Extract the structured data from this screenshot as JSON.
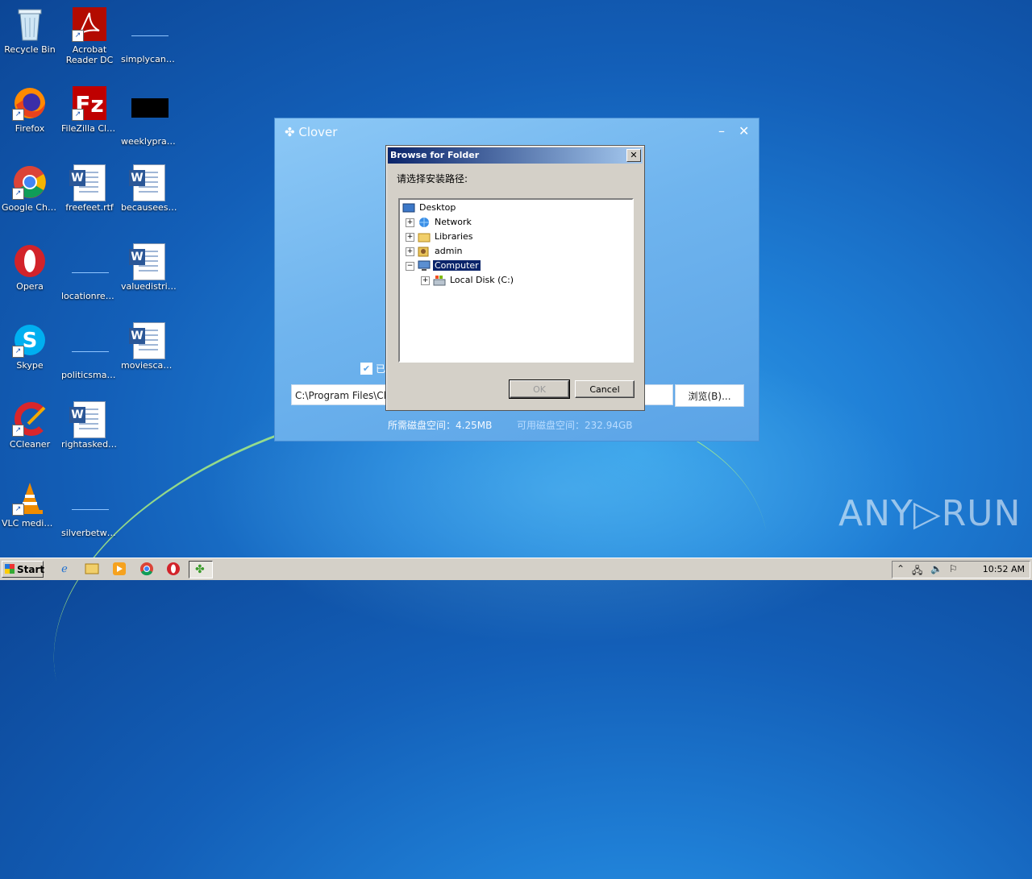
{
  "desktop": {
    "icons": [
      {
        "label": "Recycle Bin"
      },
      {
        "label": "Acrobat Reader DC"
      },
      {
        "label": "simplycance..."
      },
      {
        "label": "Firefox"
      },
      {
        "label": "FileZilla Client"
      },
      {
        "label": "weeklypract..."
      },
      {
        "label": "Google Chrome"
      },
      {
        "label": "freefeet.rtf"
      },
      {
        "label": "becauseest..."
      },
      {
        "label": "Opera"
      },
      {
        "label": "locationrent..."
      },
      {
        "label": "valuedistrib..."
      },
      {
        "label": "Skype"
      },
      {
        "label": "politicsmachi..."
      },
      {
        "label": "moviescapit..."
      },
      {
        "label": "CCleaner"
      },
      {
        "label": "rightasked.rtf"
      },
      {
        "label": "VLC media player"
      },
      {
        "label": "silverbetwe..."
      }
    ]
  },
  "clover": {
    "title": "Clover",
    "checkbox_label": "已",
    "install_path": "C:\\Program Files\\Cl",
    "browse_label": "浏览(B)...",
    "required_space": "所需磁盘空间：4.25MB",
    "available_space": "可用磁盘空间：232.94GB"
  },
  "dialog": {
    "title": "Browse for Folder",
    "close_glyph": "✕",
    "prompt": "请选择安装路径:",
    "tree": [
      {
        "label": "Desktop"
      },
      {
        "label": "Network"
      },
      {
        "label": "Libraries"
      },
      {
        "label": "admin"
      },
      {
        "label": "Computer"
      },
      {
        "label": "Local Disk (C:)"
      }
    ],
    "ok_label": "OK",
    "cancel_label": "Cancel"
  },
  "taskbar": {
    "start_label": "Start",
    "clock": "10:52 AM"
  },
  "watermark": "ANY▷RUN"
}
